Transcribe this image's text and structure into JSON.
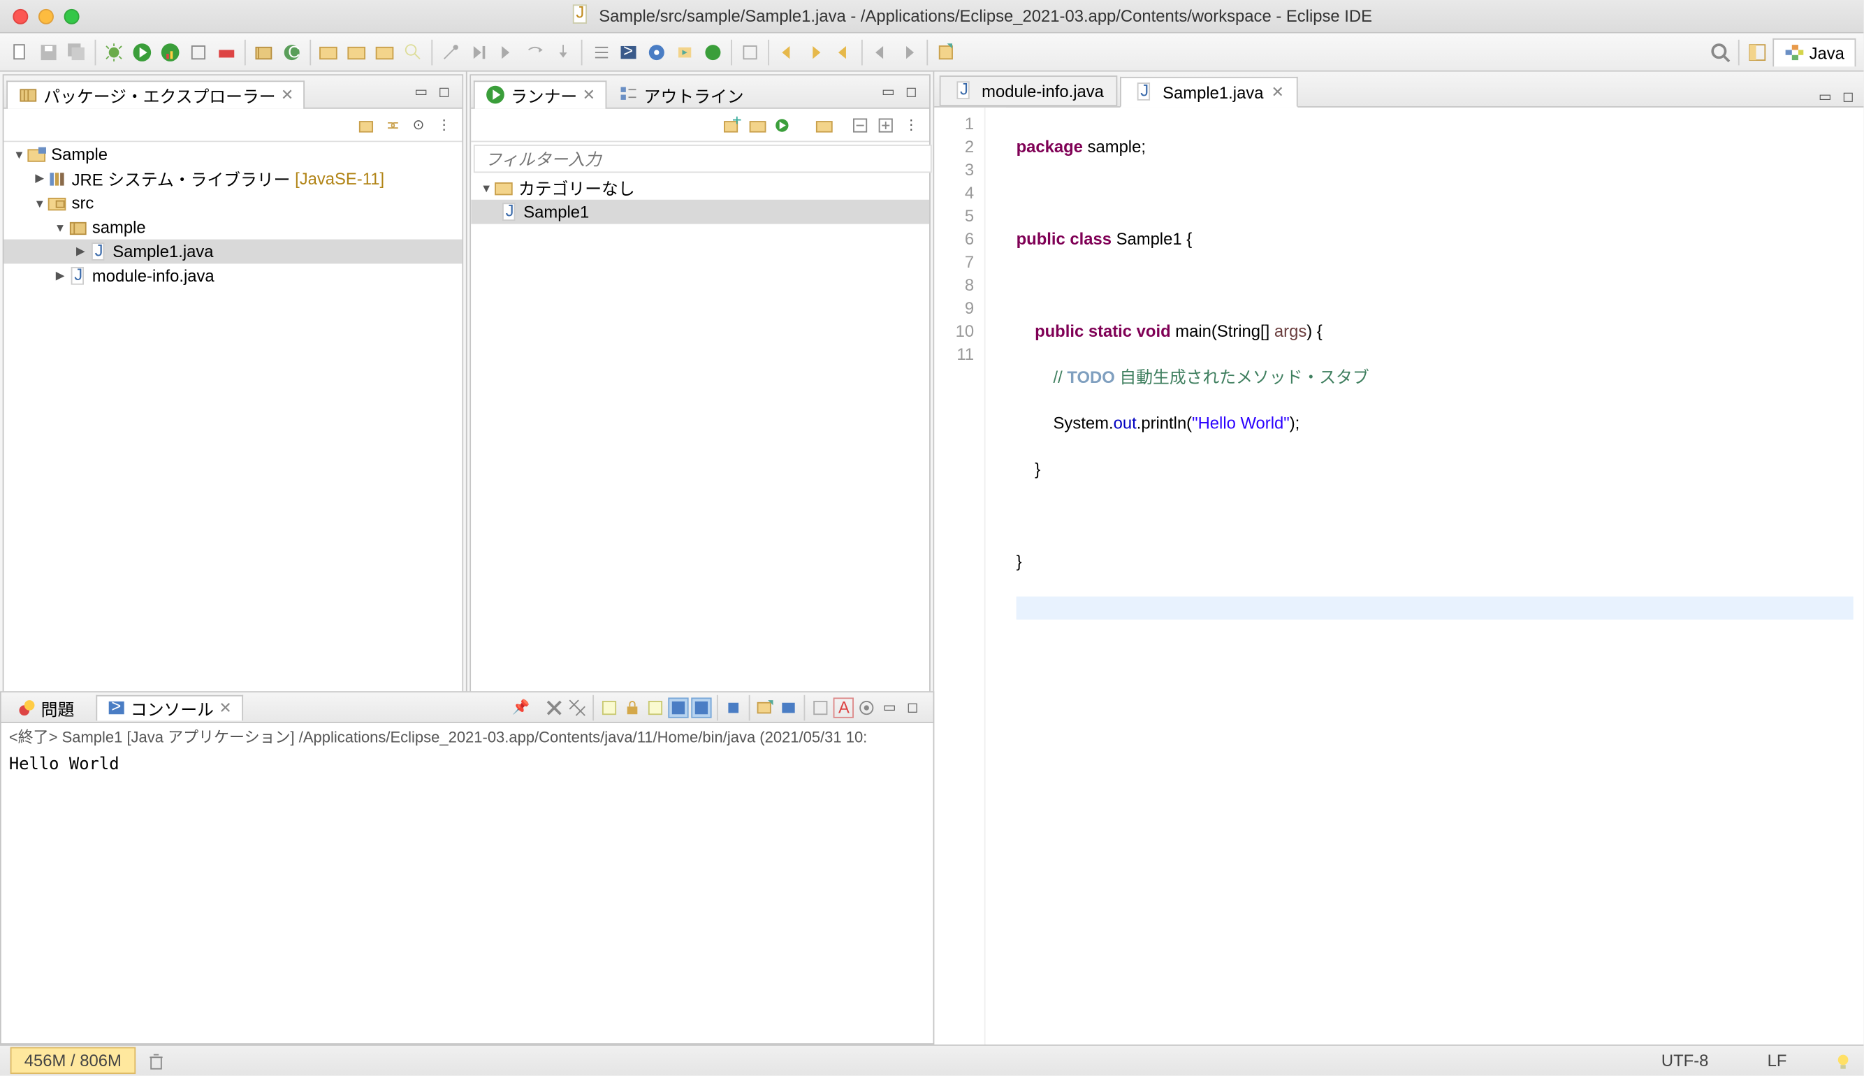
{
  "window": {
    "title": "Sample/src/sample/Sample1.java - /Applications/Eclipse_2021-03.app/Contents/workspace - Eclipse IDE"
  },
  "perspective": {
    "label": "Java"
  },
  "packageExplorer": {
    "title": "パッケージ・エクスプローラー",
    "tree": {
      "project": "Sample",
      "jre": "JRE システム・ライブラリー",
      "jre_hint": "[JavaSE-11]",
      "src": "src",
      "pkg": "sample",
      "file1": "Sample1.java",
      "file2": "module-info.java"
    }
  },
  "runner": {
    "title": "ランナー",
    "filter_placeholder": "フィルター入力",
    "category": "カテゴリーなし",
    "item1": "Sample1"
  },
  "outline": {
    "title": "アウトライン"
  },
  "editor": {
    "tab1": "module-info.java",
    "tab2": "Sample1.java",
    "code": {
      "l1_a": "package",
      "l1_b": " sample;",
      "l3_a": "public",
      "l3_b": " class",
      "l3_c": " Sample1 {",
      "l5_a": "    public",
      "l5_b": " static",
      "l5_c": " void",
      "l5_d": " main(String[] ",
      "l5_e": "args",
      "l5_f": ") {",
      "l6_a": "        // ",
      "l6_b": "TODO",
      "l6_c": " 自動生成されたメソッド・スタブ",
      "l7_a": "        System.",
      "l7_b": "out",
      "l7_c": ".println(",
      "l7_d": "\"Hello World\"",
      "l7_e": ");",
      "l8": "    }",
      "l10": "}",
      "numbers": {
        "n1": "1",
        "n2": "2",
        "n3": "3",
        "n4": "4",
        "n5": "5",
        "n6": "6",
        "n7": "7",
        "n8": "8",
        "n9": "9",
        "n10": "10",
        "n11": "11"
      }
    }
  },
  "bottom": {
    "problems_tab": "問題",
    "console_tab": "コンソール",
    "desc": "<終了> Sample1 [Java アプリケーション] /Applications/Eclipse_2021-03.app/Contents/java/11/Home/bin/java  (2021/05/31 10:",
    "output": "Hello World"
  },
  "status": {
    "heap": "456M / 806M",
    "encoding": "UTF-8",
    "linesep": "LF"
  }
}
